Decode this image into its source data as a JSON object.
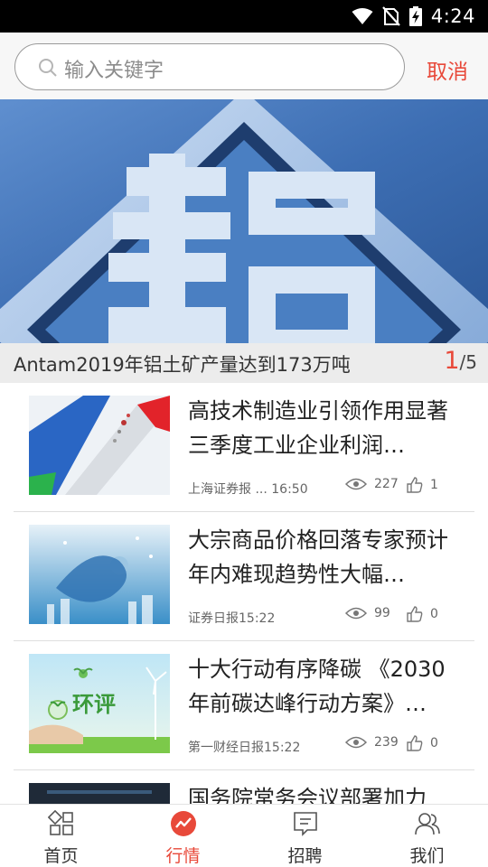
{
  "status_bar": {
    "time": "4:24"
  },
  "search": {
    "placeholder": "输入关键字",
    "cancel_label": "取消"
  },
  "banner": {
    "caption": "Antam2019年铝土矿产量达到173万吨",
    "page_current": "1",
    "page_total": "/5"
  },
  "news": [
    {
      "title": "高技术制造业引领作用显著 三季度工业企业利润…",
      "source": "上海证券报 ...",
      "time": "16:50",
      "views": "227",
      "likes": "1"
    },
    {
      "title": "大宗商品价格回落专家预计年内难现趋势性大幅…",
      "source": "证券日报",
      "time": "15:22",
      "views": "99",
      "likes": "0"
    },
    {
      "title": "十大行动有序降碳 《2030年前碳达峰行动方案》…",
      "source": "第一财经日报",
      "time": "15:22",
      "views": "239",
      "likes": "0"
    },
    {
      "title": "国务院常务会议部署加力",
      "source": "",
      "time": "",
      "views": "",
      "likes": ""
    }
  ],
  "thumb_text": {
    "huanping": "环评"
  },
  "nav": [
    {
      "label": "首页",
      "icon": "home-grid-icon",
      "active": false
    },
    {
      "label": "行情",
      "icon": "market-trend-icon",
      "active": true
    },
    {
      "label": "招聘",
      "icon": "recruit-chat-icon",
      "active": false
    },
    {
      "label": "我们",
      "icon": "users-icon",
      "active": false
    }
  ],
  "colors": {
    "accent": "#e8493a",
    "status_bar": "#000000",
    "banner_blue": "#3e6fb0"
  }
}
